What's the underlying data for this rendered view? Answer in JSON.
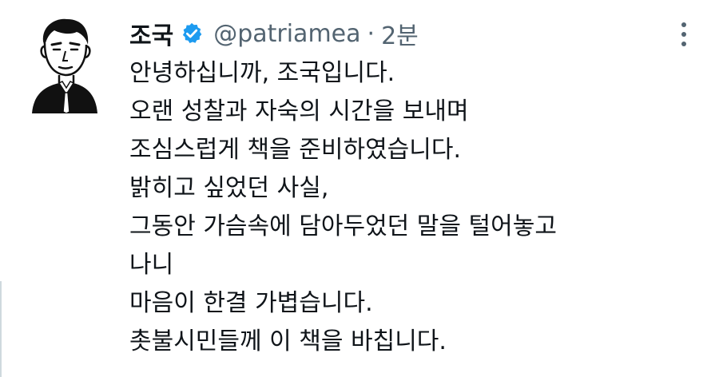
{
  "tweet": {
    "display_name": "조국",
    "handle": "@patriamea",
    "separator": "·",
    "time": "2분",
    "verified_icon": "verified-badge-icon",
    "more_icon": "more-vertical-icon",
    "lines": [
      "안녕하십니까, 조국입니다.",
      "오랜 성찰과 자숙의 시간을 보내며",
      "조심스럽게 책을 준비하였습니다.",
      "밝히고 싶었던 사실,",
      "그동안 가슴속에 담아두었던 말을 털어놓고",
      "나니",
      "마음이 한결 가볍습니다.",
      "촛불시민들께 이 책을 바칩니다."
    ]
  },
  "colors": {
    "text_primary": "#0f1419",
    "text_secondary": "#536471",
    "verified_blue": "#1d9bf0",
    "background": "#ffffff"
  }
}
